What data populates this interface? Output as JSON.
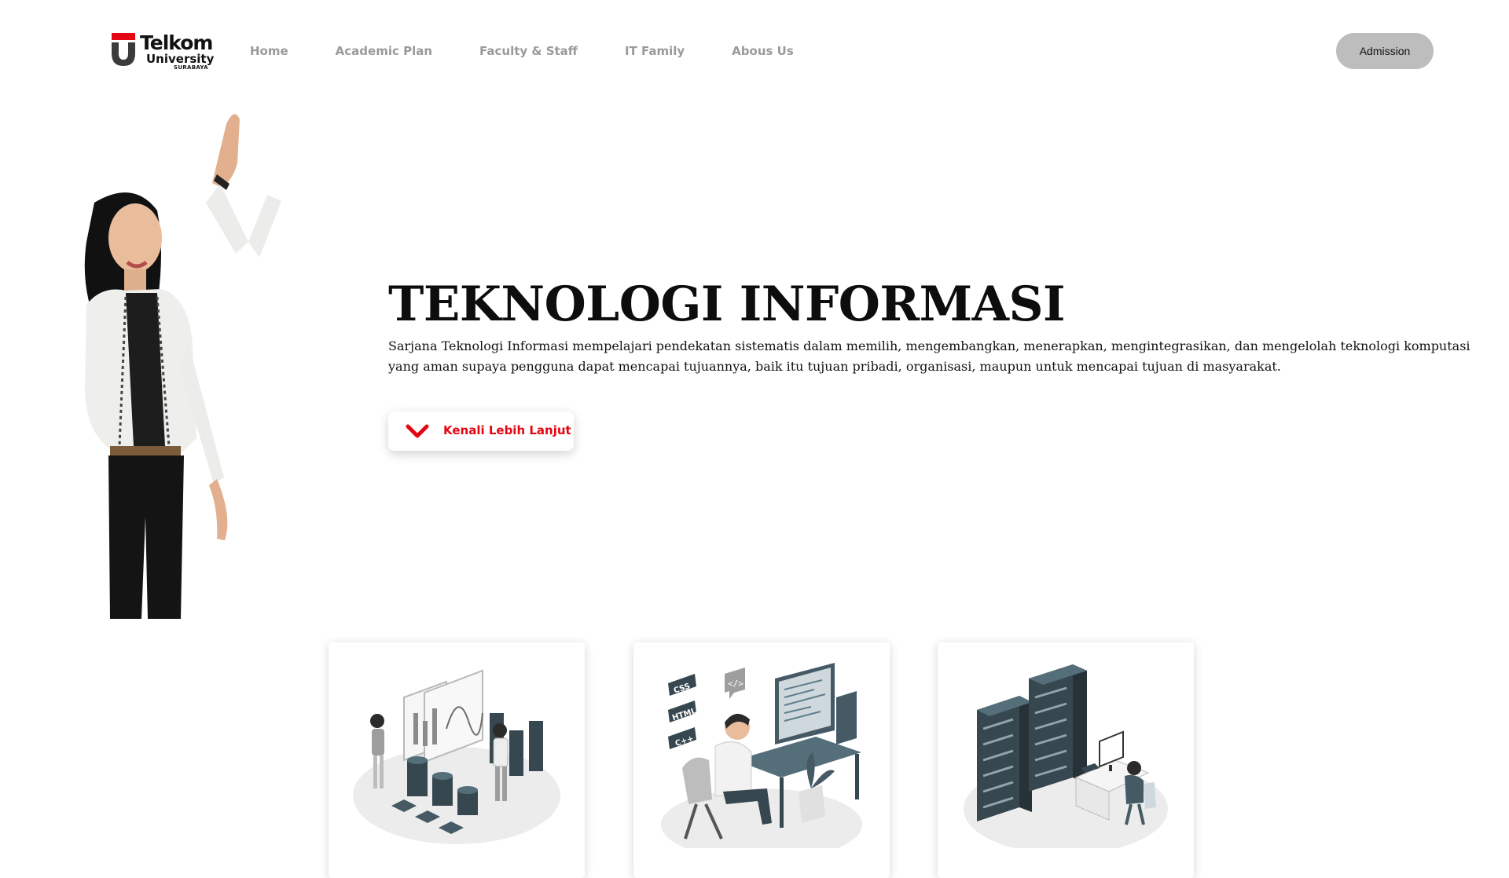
{
  "brand": {
    "name": "Telkom",
    "subtitle": "University",
    "city": "SURABAYA"
  },
  "nav": {
    "items": [
      {
        "label": "Home"
      },
      {
        "label": "Academic Plan"
      },
      {
        "label": "Faculty & Staff"
      },
      {
        "label": "IT Family"
      },
      {
        "label": "Abous Us"
      }
    ],
    "admission_label": "Admission"
  },
  "hero": {
    "title": "TEKNOLOGI INFORMASI",
    "description": "Sarjana Teknologi Informasi mempelajari pendekatan sistematis dalam memilih, mengembangkan, menerapkan, mengintegrasikan, dan mengelolah teknologi komputasi yang aman supaya pengguna dapat mencapai tujuannya, baik itu tujuan pribadi, organisasi, maupun untuk mencapai tujuan di masyarakat.",
    "cta_label": "Kenali Lebih Lanjut"
  },
  "cards": {
    "card2_tags": [
      "CSS",
      "HTML",
      "C++"
    ]
  },
  "colors": {
    "accent_red": "#e30613",
    "nav_text": "#9a9a9a",
    "admission_bg": "#bdbdbd"
  },
  "icons": {
    "cta": "chevron-down-icon"
  }
}
